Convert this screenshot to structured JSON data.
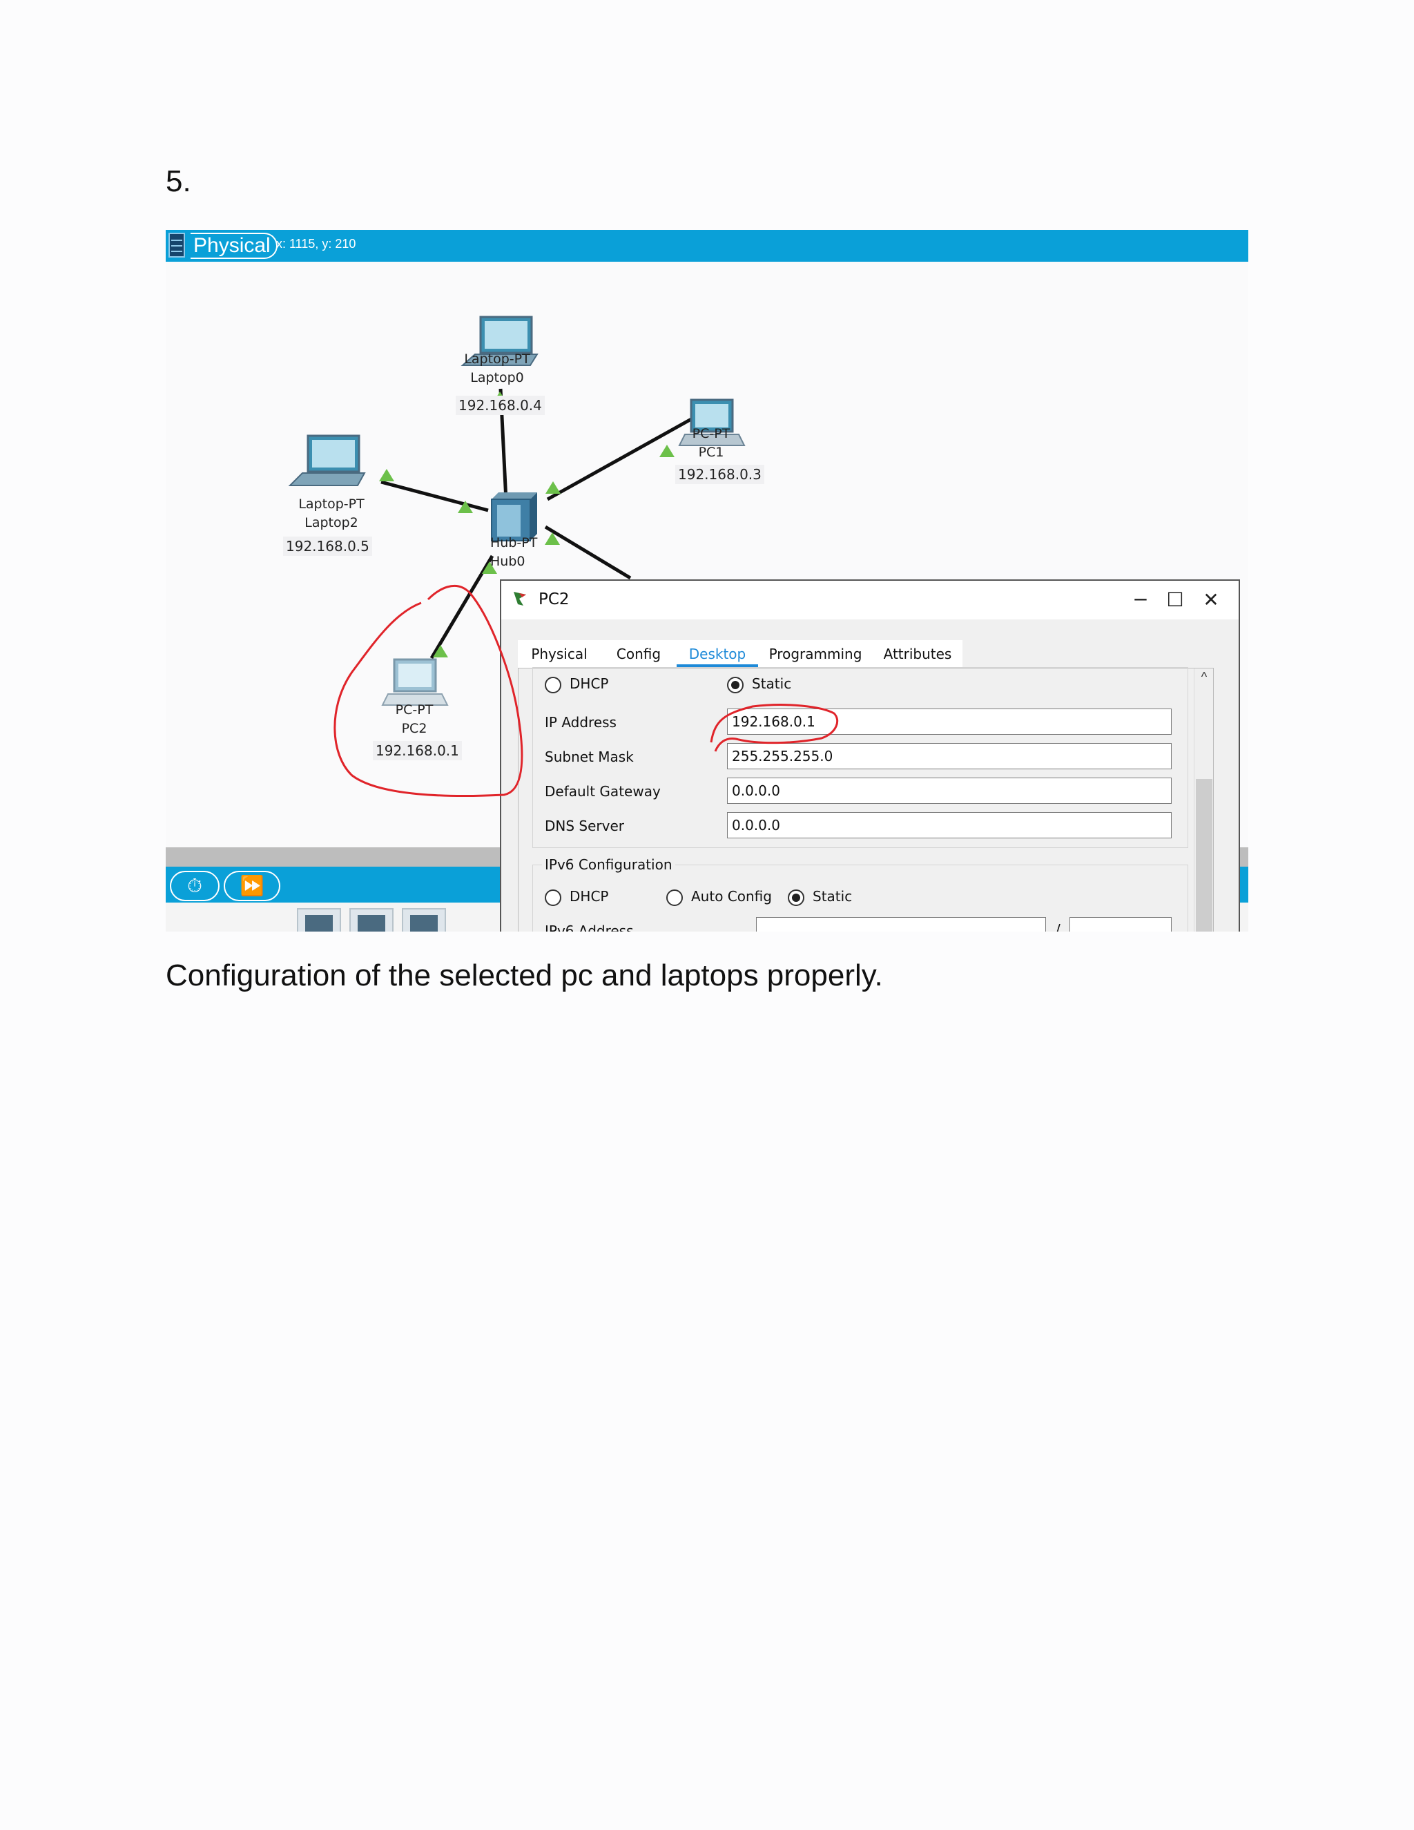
{
  "step_number": "5.",
  "caption": "Configuration of the selected pc and laptops properly.",
  "workspace": {
    "mode_label": "Physical",
    "cursor_coords": "x: 1115, y: 210"
  },
  "devices": [
    {
      "model": "Laptop-PT",
      "name": "Laptop0",
      "ip": "192.168.0.4"
    },
    {
      "model": "PC-PT",
      "name": "PC1",
      "ip": "192.168.0.3"
    },
    {
      "model": "Laptop-PT",
      "name": "Laptop2",
      "ip": "192.168.0.5"
    },
    {
      "model": "Hub-PT",
      "name": "Hub0"
    },
    {
      "model": "PC-PT",
      "name": "PC2",
      "ip": "192.168.0.1"
    }
  ],
  "dialog": {
    "title": "PC2",
    "minimize": "─",
    "maximize": "☐",
    "close": "✕",
    "tabs": [
      "Physical",
      "Config",
      "Desktop",
      "Programming",
      "Attributes"
    ],
    "active_tab": "Desktop",
    "ipv4": {
      "dhcp_label": "DHCP",
      "static_label": "Static",
      "selected": "Static",
      "ip_address_label": "IP Address",
      "ip_address": "192.168.0.1",
      "subnet_mask_label": "Subnet Mask",
      "subnet_mask": "255.255.255.0",
      "default_gateway_label": "Default Gateway",
      "default_gateway": "0.0.0.0",
      "dns_server_label": "DNS Server",
      "dns_server": "0.0.0.0"
    },
    "ipv6": {
      "section_title": "IPv6 Configuration",
      "dhcp_label": "DHCP",
      "auto_config_label": "Auto Config",
      "static_label": "Static",
      "selected": "Static",
      "address_label": "IPv6 Address",
      "prefix_separator": "/"
    }
  },
  "colors": {
    "toolbar_blue": "#0aa0d8",
    "tab_active": "#1e8ad8",
    "link_green": "#6cc04a",
    "annotation_red": "#e0242a"
  }
}
